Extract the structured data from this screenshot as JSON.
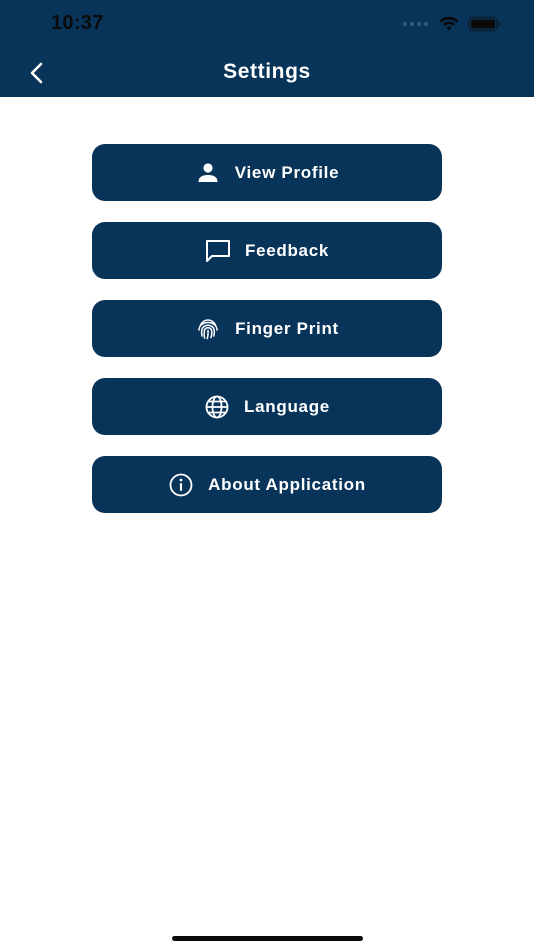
{
  "status_bar": {
    "time": "10:37"
  },
  "header": {
    "title": "Settings",
    "back_icon": "chevron-left-icon"
  },
  "colors": {
    "primary": "#08345a",
    "text_on_primary": "#ffffff",
    "background": "#ffffff"
  },
  "menu": {
    "items": [
      {
        "label": "View Profile",
        "icon": "person-icon"
      },
      {
        "label": "Feedback",
        "icon": "chat-bubble-icon"
      },
      {
        "label": "Finger Print",
        "icon": "fingerprint-icon"
      },
      {
        "label": "Language",
        "icon": "globe-icon"
      },
      {
        "label": "About Application",
        "icon": "info-icon"
      }
    ]
  }
}
